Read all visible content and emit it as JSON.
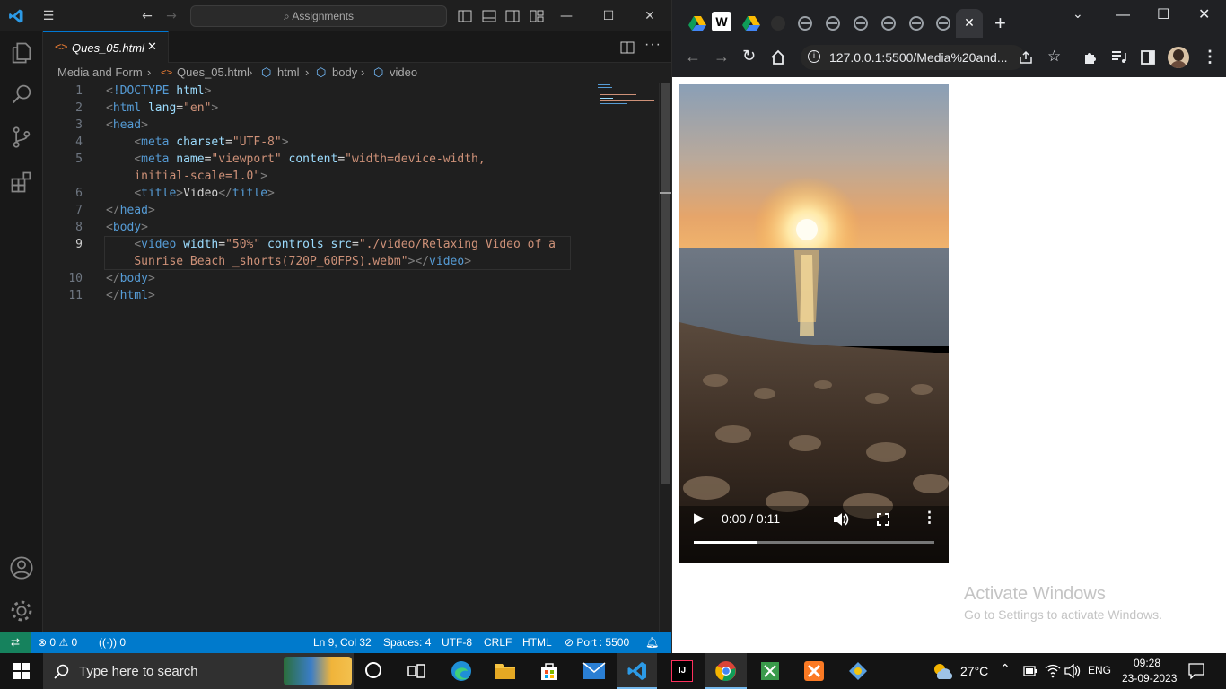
{
  "vscode": {
    "titlebar": {
      "search_text": "Assignments"
    },
    "tab": {
      "label": "Ques_05.html",
      "close_glyph": "✕"
    },
    "breadcrumb": [
      "Media and Form",
      "Ques_05.html",
      "html",
      "body",
      "video"
    ],
    "code": {
      "line_numbers": [
        "1",
        "2",
        "3",
        "4",
        "5",
        "",
        "6",
        "7",
        "8",
        "9",
        "",
        "10",
        "11"
      ],
      "lines": [
        {
          "parts": [
            [
              "punc",
              "<"
            ],
            [
              "tag",
              "!DOCTYPE"
            ],
            [
              "txt",
              " "
            ],
            [
              "attr",
              "html"
            ],
            [
              "punc",
              ">"
            ]
          ]
        },
        {
          "parts": [
            [
              "punc",
              "<"
            ],
            [
              "tag",
              "html"
            ],
            [
              "txt",
              " "
            ],
            [
              "attr",
              "lang"
            ],
            [
              "txt",
              "="
            ],
            [
              "str",
              "\"en\""
            ],
            [
              "punc",
              ">"
            ]
          ]
        },
        {
          "parts": [
            [
              "punc",
              "<"
            ],
            [
              "tag",
              "head"
            ],
            [
              "punc",
              ">"
            ]
          ]
        },
        {
          "parts": [
            [
              "txt",
              "    "
            ],
            [
              "punc",
              "<"
            ],
            [
              "tag",
              "meta"
            ],
            [
              "txt",
              " "
            ],
            [
              "attr",
              "charset"
            ],
            [
              "txt",
              "="
            ],
            [
              "str",
              "\"UTF-8\""
            ],
            [
              "punc",
              ">"
            ]
          ]
        },
        {
          "parts": [
            [
              "txt",
              "    "
            ],
            [
              "punc",
              "<"
            ],
            [
              "tag",
              "meta"
            ],
            [
              "txt",
              " "
            ],
            [
              "attr",
              "name"
            ],
            [
              "txt",
              "="
            ],
            [
              "str",
              "\"viewport\""
            ],
            [
              "txt",
              " "
            ],
            [
              "attr",
              "content"
            ],
            [
              "txt",
              "="
            ],
            [
              "str",
              "\"width=device-width,"
            ]
          ]
        },
        {
          "parts": [
            [
              "txt",
              "    "
            ],
            [
              "str",
              "initial-scale=1.0\""
            ],
            [
              "punc",
              ">"
            ]
          ]
        },
        {
          "parts": [
            [
              "txt",
              "    "
            ],
            [
              "punc",
              "<"
            ],
            [
              "tag",
              "title"
            ],
            [
              "punc",
              ">"
            ],
            [
              "txt",
              "Video"
            ],
            [
              "punc",
              "</"
            ],
            [
              "tag",
              "title"
            ],
            [
              "punc",
              ">"
            ]
          ]
        },
        {
          "parts": [
            [
              "punc",
              "</"
            ],
            [
              "tag",
              "head"
            ],
            [
              "punc",
              ">"
            ]
          ]
        },
        {
          "parts": [
            [
              "punc",
              "<"
            ],
            [
              "tag",
              "body"
            ],
            [
              "punc",
              ">"
            ]
          ]
        },
        {
          "parts": [
            [
              "txt",
              "    "
            ],
            [
              "punc",
              "<"
            ],
            [
              "tag",
              "video"
            ],
            [
              "txt",
              " "
            ],
            [
              "attr",
              "width"
            ],
            [
              "txt",
              "="
            ],
            [
              "str",
              "\"50%\""
            ],
            [
              "txt",
              " "
            ],
            [
              "attr",
              "controls"
            ],
            [
              "txt",
              " "
            ],
            [
              "attr",
              "src"
            ],
            [
              "txt",
              "="
            ],
            [
              "str",
              "\""
            ],
            [
              "link",
              "./video/Relaxing Video of a"
            ]
          ]
        },
        {
          "parts": [
            [
              "txt",
              "    "
            ],
            [
              "link",
              "Sunrise Beach _shorts(720P_60FPS).webm"
            ],
            [
              "str",
              "\""
            ],
            [
              "punc",
              "></"
            ],
            [
              "tag",
              "video"
            ],
            [
              "punc",
              ">"
            ]
          ]
        },
        {
          "parts": [
            [
              "punc",
              "</"
            ],
            [
              "tag",
              "body"
            ],
            [
              "punc",
              ">"
            ]
          ]
        },
        {
          "parts": [
            [
              "punc",
              "</"
            ],
            [
              "tag",
              "html"
            ],
            [
              "punc",
              ">"
            ]
          ]
        }
      ]
    },
    "statusbar": {
      "errors": "0",
      "warnings": "0",
      "ports": "0",
      "position": "Ln 9, Col 32",
      "spaces": "Spaces: 4",
      "encoding": "UTF-8",
      "eol": "CRLF",
      "language": "HTML",
      "port": "Port : 5500"
    }
  },
  "chrome": {
    "address": "127.0.0.1:5500/Media%20and...",
    "video": {
      "time": "0:00 / 0:11",
      "progress": 0.26
    },
    "watermark": {
      "title": "Activate Windows",
      "subtitle": "Go to Settings to activate Windows."
    }
  },
  "taskbar": {
    "search_placeholder": "Type here to search",
    "weather": "27°C",
    "language": "ENG",
    "time": "09:28",
    "date": "23-09-2023"
  }
}
